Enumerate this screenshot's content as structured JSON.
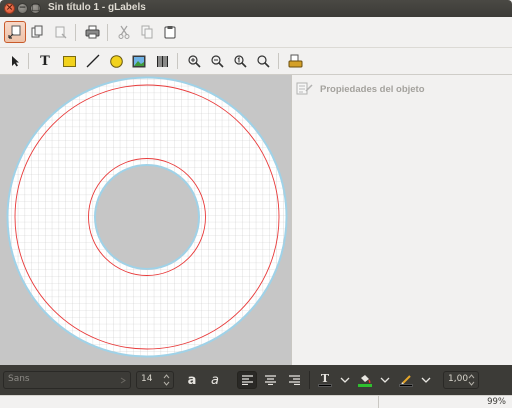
{
  "window": {
    "title": "Sin título 1 - gLabels",
    "close_glyph": "×",
    "min_glyph": "−",
    "max_glyph": "□"
  },
  "toolbar_main": {
    "items": [
      {
        "name": "new-icon",
        "active": true
      },
      {
        "name": "open-icon"
      },
      {
        "name": "save-icon"
      },
      {
        "name": "print-icon"
      },
      {
        "name": "cut-icon"
      },
      {
        "name": "copy-icon"
      },
      {
        "name": "paste-icon"
      }
    ]
  },
  "toolbar_drawing": {
    "text_tool_glyph": "T",
    "items": [
      "arrow-icon",
      "text-icon",
      "box-icon",
      "line-icon",
      "ellipse-icon",
      "image-icon",
      "barcode-icon",
      "zoom-in-icon",
      "zoom-out-icon",
      "zoom-one-icon",
      "zoom-fit-icon",
      "merge-properties-icon"
    ]
  },
  "properties_panel": {
    "title": "Propiedades del objeto"
  },
  "text_toolbar": {
    "font_family": "Sans",
    "font_size": "14",
    "bold_glyph": "a",
    "italic_glyph": "a",
    "text_color_glyph": "T",
    "line_width": "1,00",
    "colors": {
      "text": "#000000",
      "fill": "#2fbf2f",
      "line": "#000000"
    }
  },
  "status": {
    "zoom": "99%"
  },
  "colors": {
    "canvas_bg": "#c6c6c6",
    "label_fill": "#ffffff",
    "grid": "#c8c8c8",
    "margin": "#e83a3a",
    "outline": "#9fd2e8"
  }
}
